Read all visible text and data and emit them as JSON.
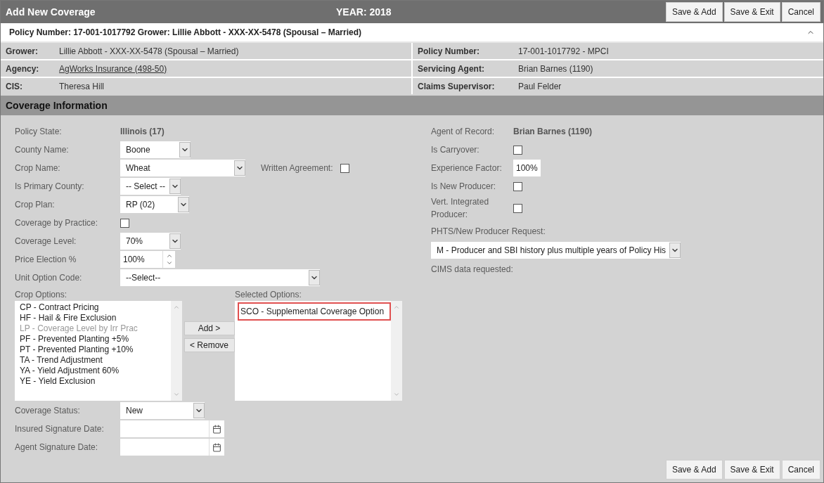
{
  "header": {
    "title": "Add New Coverage",
    "year": "YEAR: 2018",
    "buttons": [
      "Save & Add",
      "Save & Exit",
      "Cancel"
    ]
  },
  "summary": {
    "text": "Policy Number: 17-001-1017792 Grower: Lillie Abbott - XXX-XX-5478 (Spousal – Married)",
    "expanded": true
  },
  "info_rows": [
    {
      "left": {
        "label": "Grower:",
        "value": "Lillie Abbott - XXX-XX-5478 (Spousal – Married)",
        "kind": "text"
      },
      "right": {
        "label": "Policy Number:",
        "value": "17-001-1017792 - MPCI"
      }
    },
    {
      "left": {
        "label": "Agency:",
        "value": "AgWorks Insurance (498-50)",
        "kind": "link"
      },
      "right": {
        "label": "Servicing Agent:",
        "value": "Brian Barnes (1190)"
      }
    },
    {
      "left": {
        "label": "CIS:",
        "value": "Theresa Hill",
        "kind": "text"
      },
      "right": {
        "label": "Claims Supervisor:",
        "value": "Paul Felder"
      }
    }
  ],
  "section_title": "Coverage Information",
  "left_fields": [
    {
      "kind": "static",
      "label": "Policy State:",
      "value": "Illinois (17)"
    },
    {
      "kind": "select",
      "label": "County Name:",
      "value": "Boone"
    },
    {
      "kind": "select",
      "label": "Crop Name:",
      "value": "Wheat",
      "extra": {
        "label": "Written Agreement:",
        "checked": false
      }
    },
    {
      "kind": "select",
      "label": "Is Primary County:",
      "value": "-- Select --"
    },
    {
      "kind": "select",
      "label": "Crop Plan:",
      "value": "RP (02)"
    },
    {
      "kind": "checkbox",
      "label": "Coverage by Practice:",
      "checked": false
    },
    {
      "kind": "select",
      "label": "Coverage Level:",
      "value": "70%"
    },
    {
      "kind": "spinner",
      "label": "Price Election %",
      "value": "100%"
    },
    {
      "kind": "select",
      "label": "Unit Option Code:",
      "value": "--Select--"
    }
  ],
  "right_fields": [
    {
      "kind": "static",
      "label": "Agent of Record:",
      "value": "Brian Barnes (1190)"
    },
    {
      "kind": "checkbox",
      "label": "Is Carryover:",
      "checked": false
    },
    {
      "kind": "input",
      "label": "Experience Factor:",
      "value": "100%"
    },
    {
      "kind": "checkbox",
      "label": "Is New Producer:",
      "checked": false
    },
    {
      "kind": "checkbox",
      "label": "Vert. Integrated Producer:",
      "checked": false
    }
  ],
  "phts": {
    "label": "PHTS/New Producer Request:",
    "value": "M - Producer and SBI history plus multiple years of Policy His"
  },
  "cims_label": "CIMS data requested:",
  "crop_options": {
    "label": "Crop Options:",
    "items": [
      {
        "label": "CP - Contract Pricing",
        "disabled": false
      },
      {
        "label": "HF - Hail & Fire Exclusion",
        "disabled": false
      },
      {
        "label": "LP - Coverage Level by Irr Prac",
        "disabled": true
      },
      {
        "label": "PF - Prevented Planting +5%",
        "disabled": false
      },
      {
        "label": "PT - Prevented Planting +10%",
        "disabled": false
      },
      {
        "label": "TA - Trend Adjustment",
        "disabled": false
      },
      {
        "label": "YA - Yield Adjustment 60%",
        "disabled": false
      },
      {
        "label": "YE - Yield Exclusion",
        "disabled": false
      }
    ]
  },
  "move_buttons": [
    "Add >",
    "< Remove"
  ],
  "selected_options": {
    "label": "Selected Options:",
    "items": [
      {
        "label": "SCO - Supplemental Coverage Option",
        "selected": true
      }
    ]
  },
  "bottom_fields": [
    {
      "kind": "select",
      "label": "Coverage Status:",
      "value": "New"
    },
    {
      "kind": "date",
      "label": "Insured Signature Date:"
    },
    {
      "kind": "date",
      "label": "Agent Signature Date:"
    }
  ],
  "footer_buttons": [
    "Save & Add",
    "Save & Exit",
    "Cancel"
  ]
}
